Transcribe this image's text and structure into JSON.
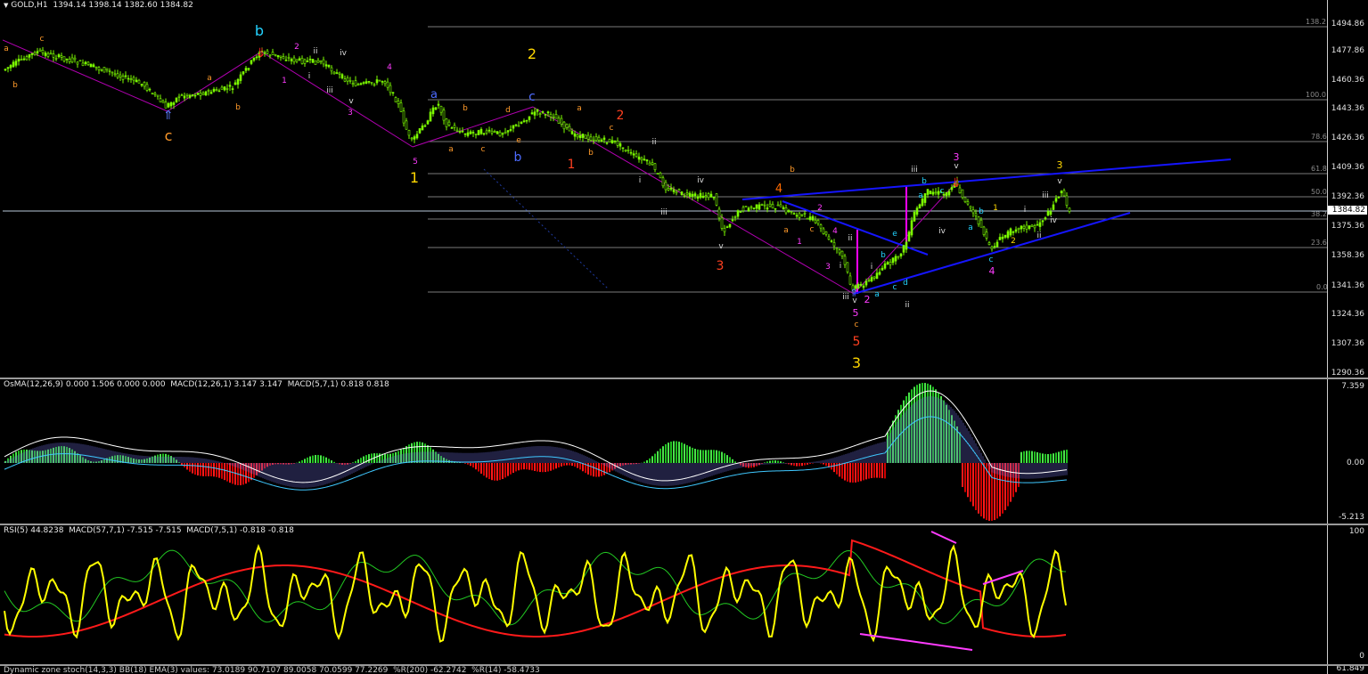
{
  "main": {
    "header": "GOLD,H1  1394.14 1398.14 1382.60 1384.82",
    "current_price": "1384.82",
    "price_ticks": [
      "1494.86",
      "1477.86",
      "1460.36",
      "1443.36",
      "1426.36",
      "1409.36",
      "1392.36",
      "1375.36",
      "1358.36",
      "1341.36",
      "1324.36",
      "1307.36",
      "1290.36"
    ],
    "fib_levels": [
      "138.2",
      "100.0",
      "78.6",
      "61.8",
      "50.0",
      "38.2",
      "23.6",
      "0.0"
    ],
    "colors": {
      "up_candle": "#7cfc00",
      "down_candle": "#7cfc00",
      "trend_line": "#1515ff",
      "channel": "#c000c0",
      "hline": "#b8c8d8"
    },
    "wave_labels": [
      {
        "t": "c",
        "c": "#ff9a2a"
      },
      {
        "t": "b",
        "c": "#23d3ff"
      },
      {
        "t": "a",
        "c": "#23d3ff"
      },
      {
        "t": "2",
        "c": "#ffd700"
      },
      {
        "t": "c",
        "c": "#4d6bff"
      },
      {
        "t": "a",
        "c": "#4d6bff"
      },
      {
        "t": "b",
        "c": "#4d6bff"
      },
      {
        "t": "1",
        "c": "#ffd700"
      },
      {
        "t": "2",
        "c": "#ff4020"
      },
      {
        "t": "1",
        "c": "#ff4020"
      },
      {
        "t": "3",
        "c": "#ff4020"
      },
      {
        "t": "4",
        "c": "#ff6a00"
      },
      {
        "t": "5",
        "c": "#ff4020"
      },
      {
        "t": "3",
        "c": "#ffd700"
      },
      {
        "t": "3",
        "c": "#ff3cff"
      },
      {
        "t": "4",
        "c": "#ff3cff"
      },
      {
        "t": "3",
        "c": "#ffd700"
      },
      {
        "t": "5",
        "c": "#ff3cff"
      },
      {
        "t": "2",
        "c": "#ff3cff"
      }
    ]
  },
  "osma": {
    "header": "OsMA(12,26,9) 0.000 1.506 0.000 0.000  MACD(12,26,1) 3.147 3.147  MACD(5,7,1) 0.818 0.818",
    "ticks": [
      "7.359",
      "0.00",
      "-5.213"
    ]
  },
  "rsi": {
    "header": "RSI(5) 44.8238  MACD(57,7,1) -7.515 -7.515  MACD(7,5,1) -0.818 -0.818",
    "ticks": [
      "100",
      "0"
    ]
  },
  "bottom": {
    "header": "Dynamic zone stoch(14,3,3) BB(18) EMA(3) values: 73.0189 90.7107 89.0058 70.0599 77.2269  %R(200) -62.2742  %R(14) -58.4733",
    "tick": "61.849"
  }
}
